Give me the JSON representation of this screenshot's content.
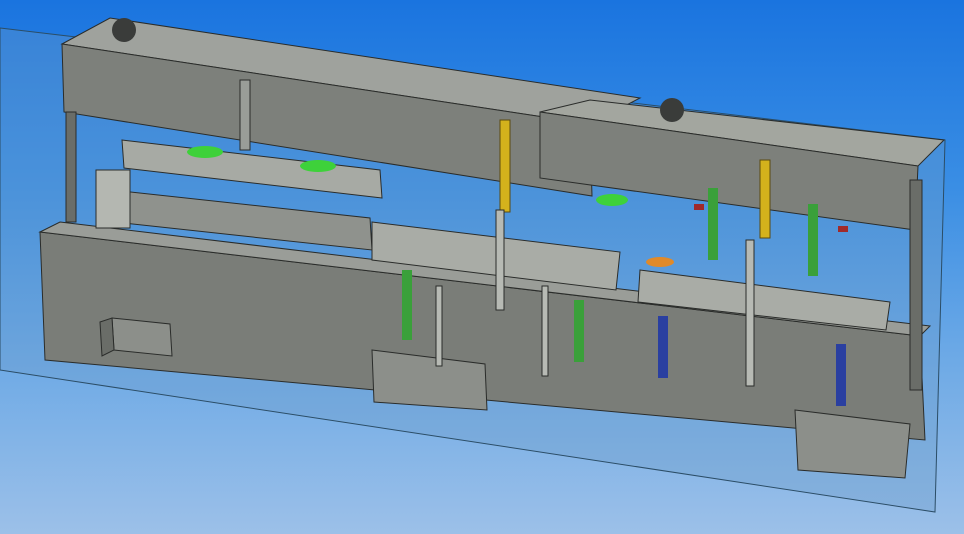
{
  "viewport": {
    "background_top": "#1a74df",
    "background_bottom": "#9cc0e8"
  },
  "model": {
    "body_color": "#7c7f7a",
    "face_light": "#9b9e99",
    "face_dark": "#5d605b",
    "edge_color": "#2a2c2a",
    "spring_green": "#3aa03a",
    "spring_blue": "#2a3fa0",
    "spring_red": "#a02a2a",
    "pin_yellow": "#d4b21c",
    "disc_green": "#3ed13a",
    "disc_orange": "#e08a2a",
    "section_plane": "#6a9cc8"
  },
  "icons": {
    "section-plane": "translucent-plane",
    "die-assembly": "cad-model"
  }
}
